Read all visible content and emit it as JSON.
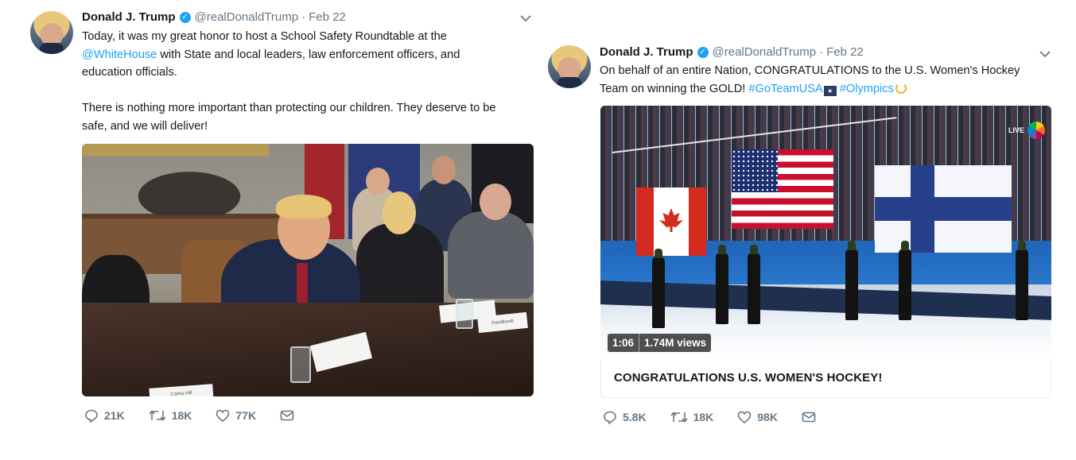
{
  "tweets": [
    {
      "author": {
        "name": "Donald J. Trump",
        "handle": "@realDonaldTrump",
        "sep": "·",
        "date": "Feb 22"
      },
      "text": {
        "line1": "Today, it was my great honor to host a School Safety Roundtable at the",
        "mention": "@WhiteHouse",
        "line2_rest": " with State and local leaders, law enforcement officers, and",
        "line3": "education officials.",
        "para2_line1": "There is nothing more important than protecting our children. They deserve to be",
        "para2_line2": "safe, and we will deliver!"
      },
      "media": {
        "type": "photo",
        "placard1": "Carlos Hill",
        "placard2": "PamBondi"
      },
      "actions": {
        "replies": "21K",
        "retweets": "18K",
        "likes": "77K"
      }
    },
    {
      "author": {
        "name": "Donald J. Trump",
        "handle": "@realDonaldTrump",
        "sep": "·",
        "date": "Feb 22"
      },
      "text": {
        "line1": "On behalf of an entire Nation, CONGRATULATIONS to the U.S. Women's Hockey",
        "line2_start": "Team on winning the GOLD! ",
        "hashtag1": "#GoTeamUSA",
        "hashtag2": " #Olympics"
      },
      "media": {
        "type": "video",
        "duration": "1:06",
        "views": "1.74M views",
        "live_label": "LIVE",
        "broadcaster": "NBC"
      },
      "card_title": "CONGRATULATIONS U.S. WOMEN'S HOCKEY!",
      "actions": {
        "replies": "5.8K",
        "retweets": "18K",
        "likes": "98K"
      }
    }
  ],
  "icons": [
    "verified-badge-icon",
    "chevron-down-icon",
    "reply-icon",
    "retweet-icon",
    "like-icon",
    "direct-message-icon",
    "usa-flag-emoji-icon",
    "olympic-wreath-emoji-icon"
  ],
  "colors": {
    "link": "#1da1f2",
    "text": "#14171a",
    "muted": "#657786",
    "border": "#e6ecf0"
  }
}
